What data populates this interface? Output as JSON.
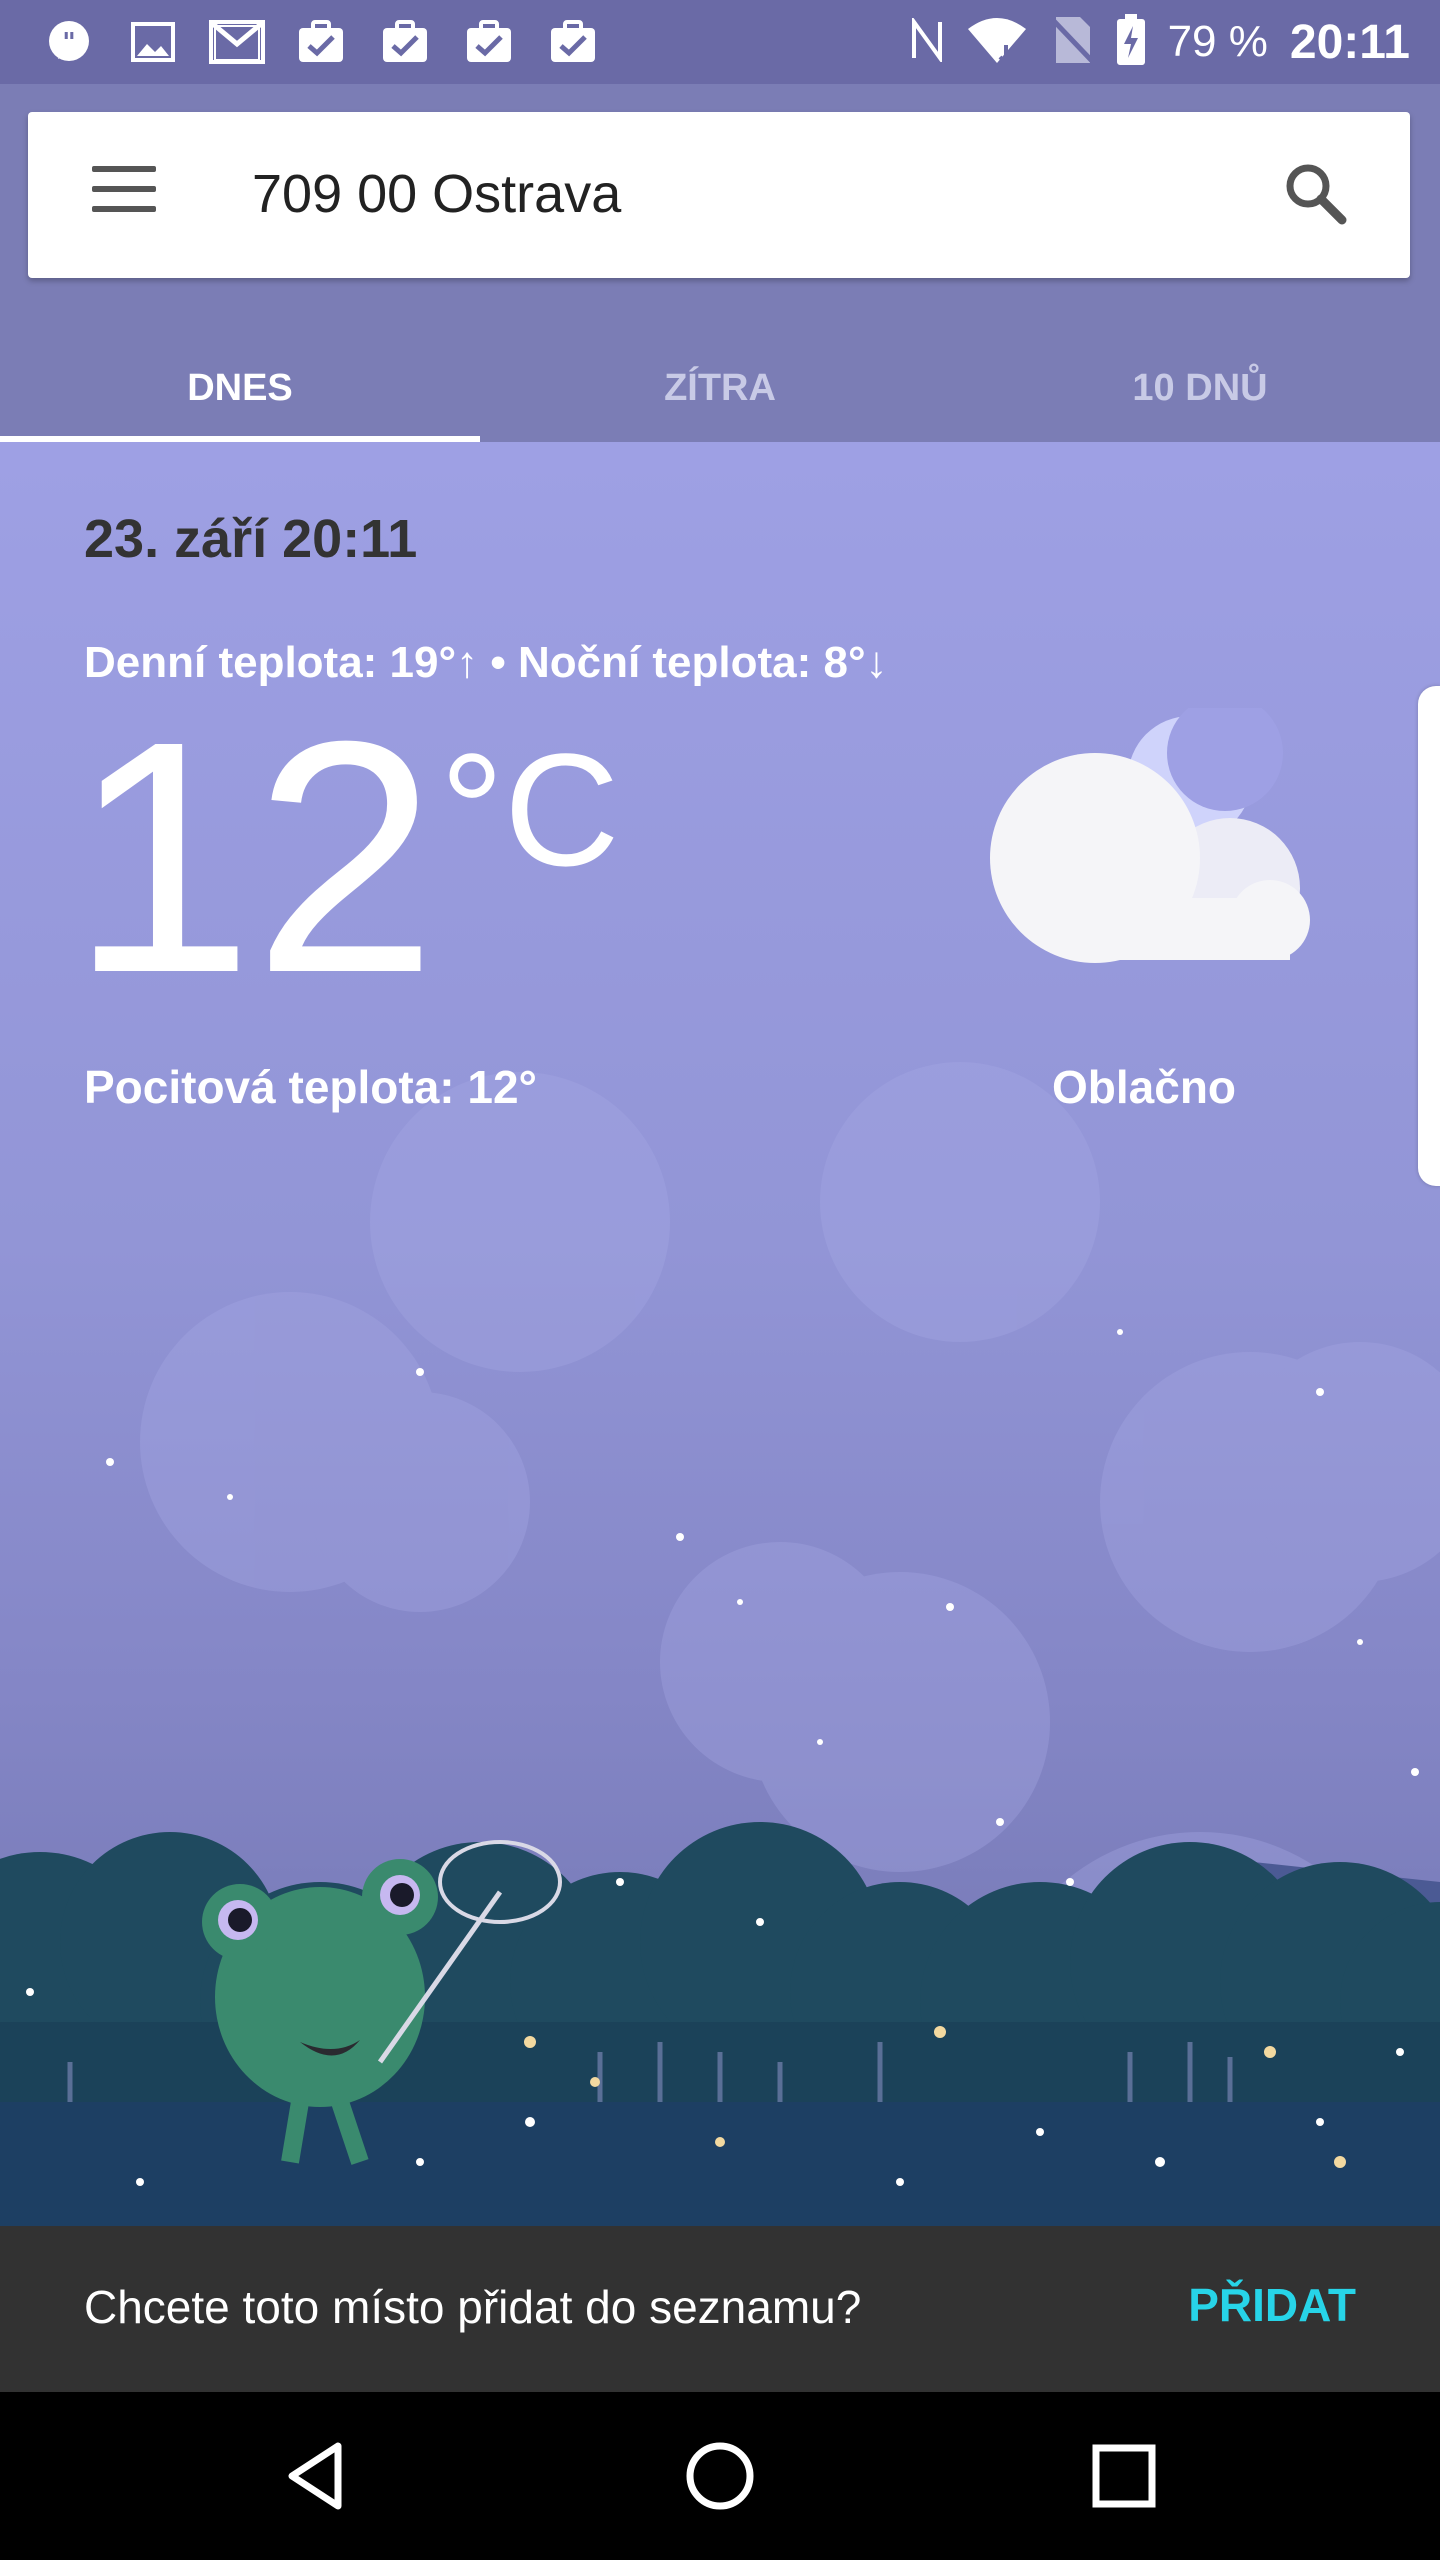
{
  "status_bar": {
    "battery": "79 %",
    "time": "20:11",
    "notification_icons": [
      "chat-bubble-icon",
      "image-icon",
      "gmail-icon",
      "task-check-icon",
      "task-check-icon",
      "task-check-icon",
      "task-check-icon"
    ],
    "system_icons": [
      "nfc-icon",
      "wifi-icon",
      "no-sim-icon",
      "battery-charging-icon"
    ]
  },
  "search": {
    "location": "709 00 Ostrava",
    "menu_icon": "hamburger-menu-icon",
    "search_icon": "search-icon"
  },
  "tabs": [
    {
      "label": "DNES",
      "active": true
    },
    {
      "label": "ZÍTRA",
      "active": false
    },
    {
      "label": "10 DNŮ",
      "active": false
    }
  ],
  "weather": {
    "date": "23. září 20:11",
    "day_night": "Denní teplota: 19°↑ • Noční teplota: 8°↓",
    "temperature": "12",
    "unit": "°C",
    "feels_like": "Pocitová teplota: 12°",
    "condition": "Oblačno",
    "condition_icon": "cloud-moon-icon"
  },
  "snackbar": {
    "message": "Chcete toto místo přidat do seznamu?",
    "action": "PŘIDAT"
  },
  "navigation": {
    "icons": [
      "back-icon",
      "home-icon",
      "recents-icon"
    ]
  },
  "colors": {
    "status_bar": "#6a6aa6",
    "header": "#7b7db5",
    "sky_top": "#9ea0e4",
    "snackbar_action": "#27d4e8"
  }
}
